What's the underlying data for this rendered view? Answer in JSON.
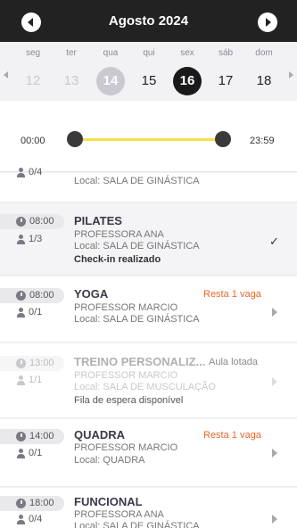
{
  "header": {
    "month_title": "Agosto 2024"
  },
  "week": {
    "days": [
      {
        "name": "seg",
        "num": "12"
      },
      {
        "name": "ter",
        "num": "13"
      },
      {
        "name": "qua",
        "num": "14"
      },
      {
        "name": "qui",
        "num": "15"
      },
      {
        "name": "sex",
        "num": "16"
      },
      {
        "name": "sáb",
        "num": "17"
      },
      {
        "name": "dom",
        "num": "18"
      }
    ]
  },
  "time_range": {
    "start": "00:00",
    "end": "23:59"
  },
  "classes": [
    {
      "time": "",
      "count": "0/4",
      "name": "",
      "instructor": "",
      "location": "Local: SALA DE GINÁSTICA",
      "status": "",
      "note": ""
    },
    {
      "time": "08:00",
      "count": "1/3",
      "name": "PILATES",
      "instructor": "PROFESSORA ANA",
      "location": "Local: SALA DE GINÁSTICA",
      "status": "",
      "note": "Check-in realizado"
    },
    {
      "time": "08:00",
      "count": "0/1",
      "name": "YOGA",
      "instructor": "PROFESSOR MARCIO",
      "location": "Local: SALA DE GINÁSTICA",
      "status": "Resta 1 vaga",
      "note": ""
    },
    {
      "time": "13:00",
      "count": "1/1",
      "name": "TREINO PERSONALIZ...",
      "instructor": "PROFESSOR MARCIO",
      "location": "Local: SALA DE MUSCULAÇÃO",
      "status": "Aula lotada",
      "note": "Fila de espera disponível"
    },
    {
      "time": "14:00",
      "count": "0/1",
      "name": "QUADRA",
      "instructor": "PROFESSOR MARCIO",
      "location": "Local: QUADRA",
      "status": "Resta 1 vaga",
      "note": ""
    },
    {
      "time": "18:00",
      "count": "0/4",
      "name": "FUNCIONAL",
      "instructor": "PROFESSORA ANA",
      "location": "Local: SALA DE GINÁSTICA",
      "status": "",
      "note": ""
    }
  ]
}
